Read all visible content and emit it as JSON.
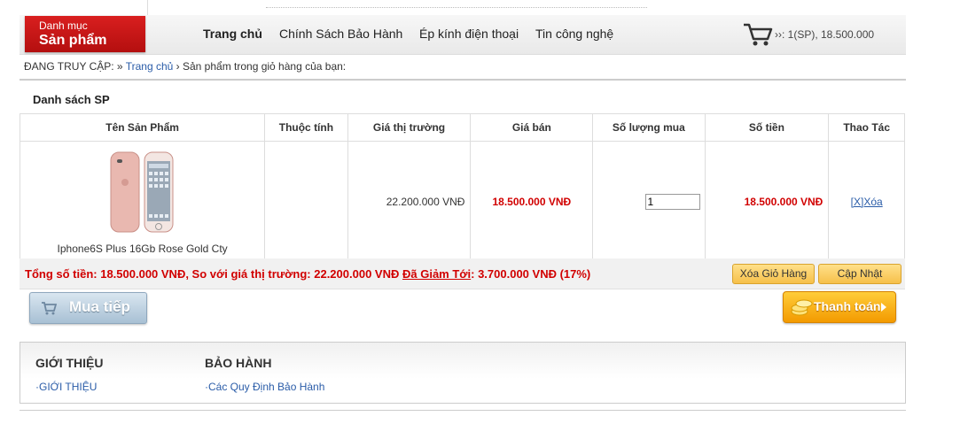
{
  "header": {
    "category_line1": "Danh mục",
    "category_line2": "Sản phẩm",
    "nav": [
      "Trang chủ",
      "Chính Sách Bảo Hành",
      "Ép kính điện thoại",
      "Tin công nghệ"
    ],
    "cart_summary": "››: 1(SP), 18.500.000"
  },
  "breadcrumb": {
    "prefix": "ĐANG TRUY CẬP: »",
    "home": "Trang chủ",
    "current": "› Sản phẩm trong giỏ hàng của bạn:"
  },
  "cart": {
    "title": "Danh sách SP",
    "columns": [
      "Tên Sản Phẩm",
      "Thuộc tính",
      "Giá thị trường",
      "Giá bán",
      "Số lượng mua",
      "Số tiền",
      "Thao Tác"
    ],
    "item": {
      "name": "Iphone6S Plus 16Gb Rose Gold Cty",
      "attributes": "",
      "market_price": "22.200.000 VNĐ",
      "sale_price": "18.500.000 VNĐ",
      "quantity": "1",
      "amount": "18.500.000 VNĐ",
      "delete_label": "[X]Xóa"
    },
    "total_part1": "Tổng số tiền: 18.500.000 VNĐ, So với giá thị trường: 22.200.000 VNĐ",
    "discount_label": "Đã Giảm Tới",
    "total_part2": ": 3.700.000 VNĐ (17%)",
    "clear_button": "Xóa Giỏ Hàng",
    "update_button": "Cập Nhật",
    "continue_button": "Mua tiếp",
    "checkout_button": "Thanh toán"
  },
  "footer": {
    "col1_heading": "GIỚI THIỆU",
    "col1_link": "·GIỚI THIỆU",
    "col2_heading": "BẢO HÀNH",
    "col2_link": "·Các Quy Định Bảo Hành"
  },
  "colors": {
    "accent_red": "#d10000",
    "category_bg": "#c41414",
    "checkout_orange": "#f39a00",
    "button_yellow": "#f6c04a",
    "link_blue": "#2a5ca8"
  }
}
